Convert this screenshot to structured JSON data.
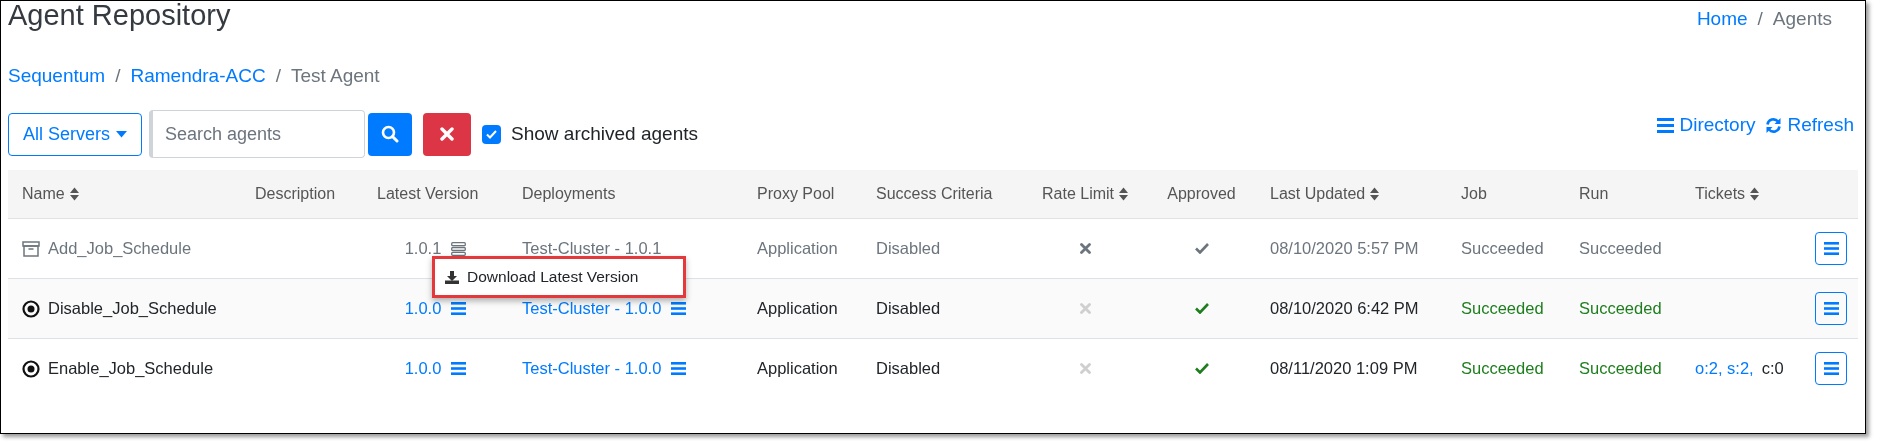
{
  "page": {
    "title": "Agent Repository",
    "top_breadcrumb": {
      "separator": "/",
      "items": [
        {
          "label": "Home",
          "link": true
        },
        {
          "label": "Agents",
          "link": false
        }
      ]
    }
  },
  "breadcrumb": {
    "separator": "/",
    "items": [
      {
        "label": "Sequentum",
        "link": true
      },
      {
        "label": "Ramendra-ACC",
        "link": true
      },
      {
        "label": "Test Agent",
        "link": false
      }
    ]
  },
  "toolbar": {
    "server_dropdown": "All Servers",
    "search": {
      "placeholder": "Search agents"
    },
    "show_archived": {
      "label": "Show archived agents",
      "checked": true
    },
    "links": [
      {
        "kind": "directory",
        "label": "Directory"
      },
      {
        "kind": "refresh",
        "label": "Refresh"
      }
    ]
  },
  "table": {
    "columns": [
      {
        "label": "Name",
        "sortable": true
      },
      {
        "label": "Description",
        "sortable": false
      },
      {
        "label": "Latest Version",
        "sortable": false
      },
      {
        "label": "Deployments",
        "sortable": false
      },
      {
        "label": "Proxy Pool",
        "sortable": false
      },
      {
        "label": "Success Criteria",
        "sortable": false
      },
      {
        "label": "Rate Limit",
        "sortable": true
      },
      {
        "label": "Approved",
        "sortable": false
      },
      {
        "label": "Last Updated",
        "sortable": true
      },
      {
        "label": "Job",
        "sortable": false
      },
      {
        "label": "Run",
        "sortable": false
      },
      {
        "label": "Tickets",
        "sortable": true
      }
    ],
    "rows": [
      {
        "archived": true,
        "name": "Add_Job_Schedule",
        "latest_version": "1.0.1",
        "deployment": "Test-Cluster - 1.0.1",
        "proxy_pool": "Application",
        "success_criteria": "Disabled",
        "rate_limited": false,
        "approved": true,
        "last_updated": "08/10/2020 5:57 PM",
        "job": "Succeeded",
        "run": "Succeeded"
      },
      {
        "archived": false,
        "name": "Disable_Job_Schedule",
        "latest_version": "1.0.0",
        "deployment": "Test-Cluster - 1.0.0",
        "proxy_pool": "Application",
        "success_criteria": "Disabled",
        "rate_limited": false,
        "approved": true,
        "last_updated": "08/10/2020 6:42 PM",
        "job": "Succeeded",
        "run": "Succeeded"
      },
      {
        "archived": false,
        "name": "Enable_Job_Schedule",
        "latest_version": "1.0.0",
        "deployment": "Test-Cluster - 1.0.0",
        "proxy_pool": "Application",
        "success_criteria": "Disabled",
        "rate_limited": false,
        "approved": true,
        "last_updated": "08/11/2020 1:09 PM",
        "job": "Succeeded",
        "run": "Succeeded",
        "tickets_open": "o:2, s:2,",
        "tickets_closed": "c:0"
      }
    ]
  },
  "version_menu": {
    "items": [
      "Download Latest Version"
    ]
  }
}
